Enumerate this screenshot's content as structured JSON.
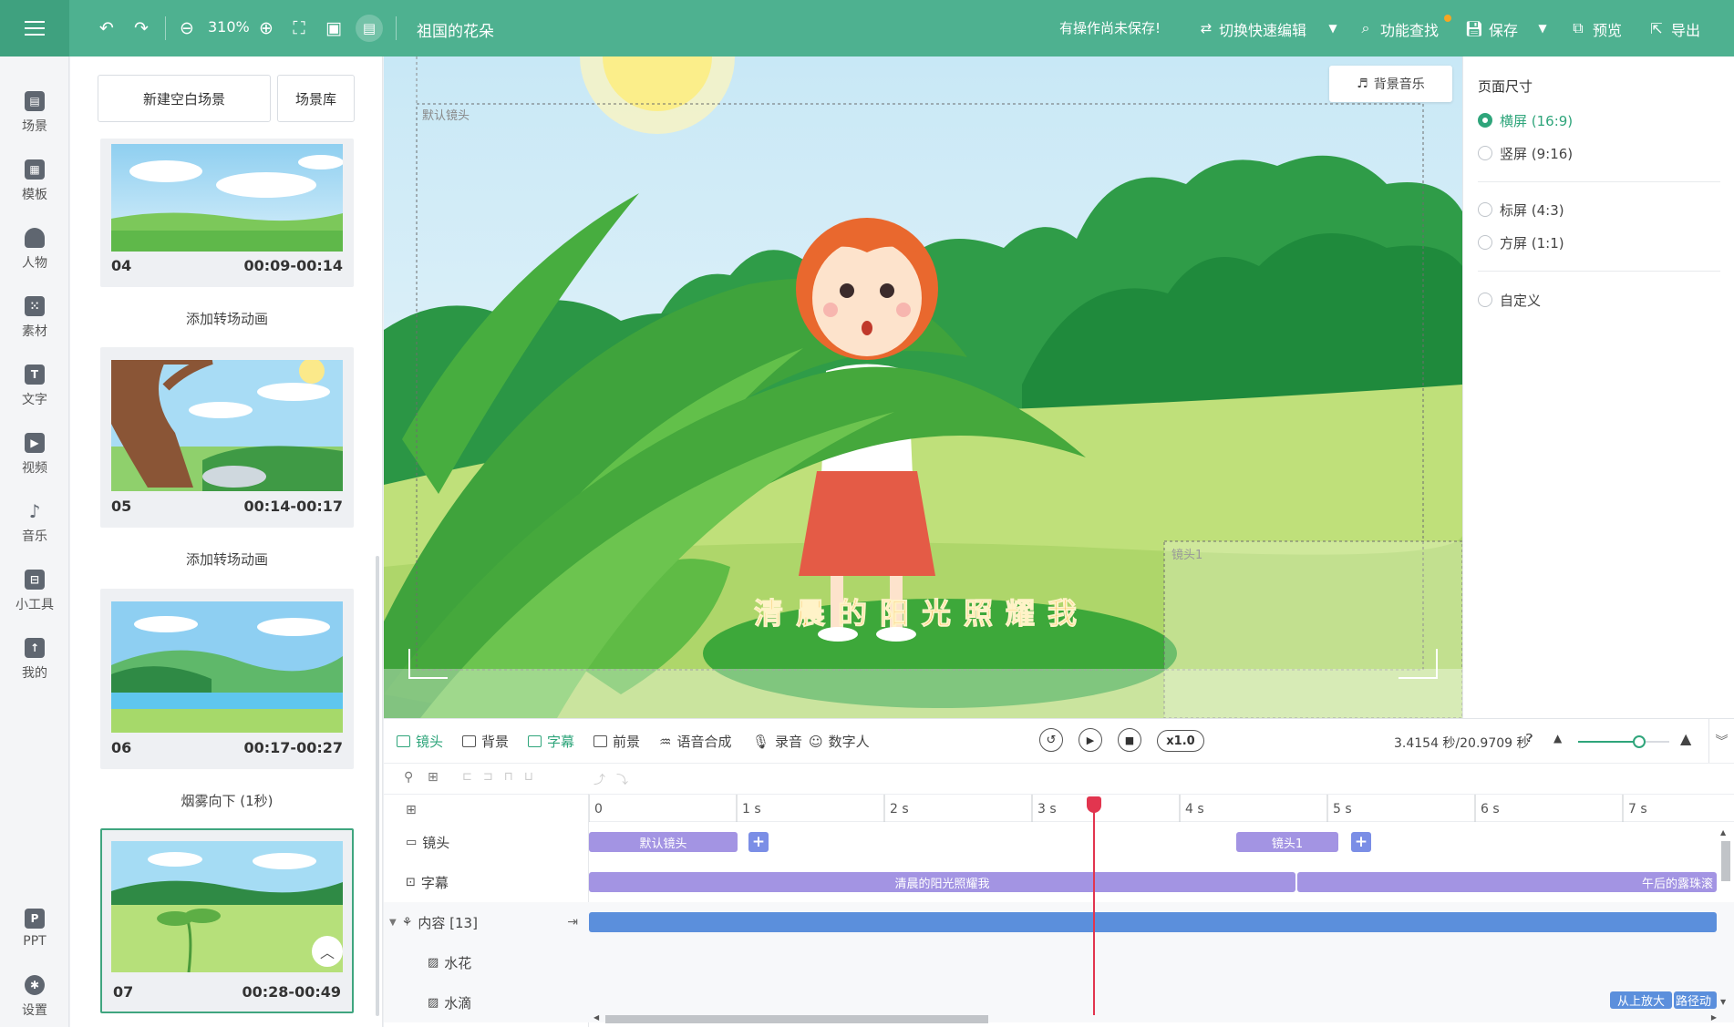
{
  "header": {
    "zoom": "310%",
    "project_title": "祖国的花朵",
    "unsaved_notice": "有操作尚未保存!",
    "switch_label": "切换快速编辑",
    "find_label": "功能查找",
    "save_label": "保存",
    "preview_label": "预览",
    "export_label": "导出"
  },
  "sidebar": {
    "items": [
      {
        "label": "场景",
        "icon": "scene-icon"
      },
      {
        "label": "模板",
        "icon": "template-icon"
      },
      {
        "label": "人物",
        "icon": "person-icon"
      },
      {
        "label": "素材",
        "icon": "material-icon"
      },
      {
        "label": "文字",
        "icon": "text-icon"
      },
      {
        "label": "视频",
        "icon": "video-icon"
      },
      {
        "label": "音乐",
        "icon": "music-icon"
      },
      {
        "label": "小工具",
        "icon": "toolbox-icon"
      },
      {
        "label": "我的",
        "icon": "upload-icon"
      },
      {
        "label": "PPT",
        "icon": "ppt-icon"
      },
      {
        "label": "设置",
        "icon": "gear-icon"
      }
    ]
  },
  "scenes": {
    "new_blank": "新建空白场景",
    "library": "场景库",
    "list": [
      {
        "num": "04",
        "time": "00:09-00:14"
      },
      {
        "num": "05",
        "time": "00:14-00:17"
      },
      {
        "num": "06",
        "time": "00:17-00:27"
      },
      {
        "num": "07",
        "time": "00:28-00:49"
      }
    ],
    "transitions": [
      "添加转场动画",
      "添加转场动画",
      "烟雾向下 (1秒)"
    ]
  },
  "canvas": {
    "bg_music": "背景音乐",
    "default_camera": "默认镜头",
    "camera1": "镜头1",
    "subtitle": "清晨的阳光照耀我"
  },
  "page_size": {
    "title": "页面尺寸",
    "options": [
      {
        "label": "横屏 (16:9)",
        "selected": true
      },
      {
        "label": "竖屏 (9:16)",
        "selected": false
      },
      {
        "label": "标屏 (4:3)",
        "selected": false
      },
      {
        "label": "方屏 (1:1)",
        "selected": false
      },
      {
        "label": "自定义",
        "selected": false
      }
    ]
  },
  "timeline": {
    "tools": [
      "镜头",
      "背景",
      "字幕",
      "前景",
      "语音合成",
      "录音",
      "数字人"
    ],
    "speed": "x1.0",
    "time_readout": "3.4154 秒/20.9709 秒",
    "ticks": [
      "0",
      "1 s",
      "2 s",
      "3 s",
      "4 s",
      "5 s",
      "6 s",
      "7 s"
    ],
    "tracks": {
      "camera": "镜头",
      "subtitle": "字幕",
      "content": "内容 [13]",
      "splash": "水花",
      "droplet": "水滴"
    },
    "clips": {
      "default_camera": "默认镜头",
      "camera1": "镜头1",
      "subtitle1": "清晨的阳光照耀我",
      "subtitle2": "午后的露珠滚",
      "anim1": "从上放大",
      "anim2": "路径动"
    }
  },
  "colors": {
    "brand": "#4eb190",
    "accent": "#2fa57b",
    "clip_purple": "#a394e3",
    "clip_blue": "#5b8fdc",
    "playhead": "#e2354f"
  }
}
